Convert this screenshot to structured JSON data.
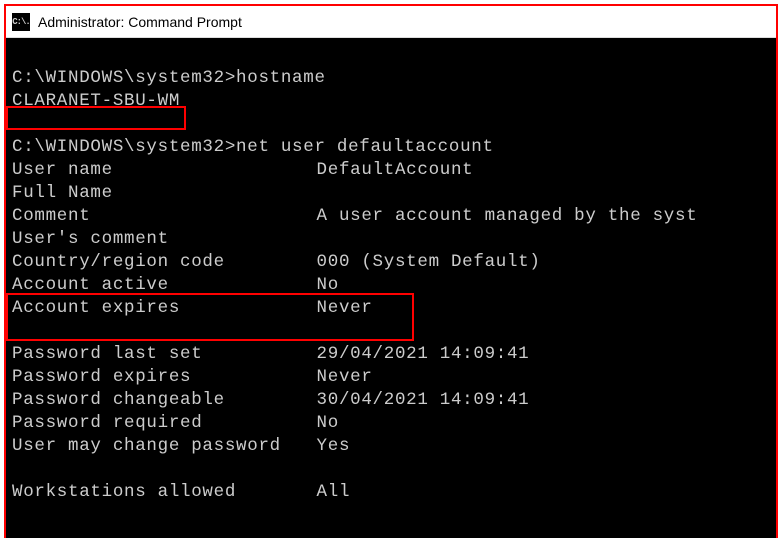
{
  "titlebar": {
    "icon_glyph": "C:\\.",
    "title": "Administrator: Command Prompt"
  },
  "terminal": {
    "prompt1_path": "C:\\WINDOWS\\system32>",
    "cmd1": "hostname",
    "hostname_out": "CLARANET-SBU-WM",
    "prompt2_path": "C:\\WINDOWS\\system32>",
    "cmd2": "net user defaultaccount",
    "rows": {
      "user_name_label": "User name",
      "user_name_value": "DefaultAccount",
      "full_name_label": "Full Name",
      "full_name_value": "",
      "comment_label": "Comment",
      "comment_value": "A user account managed by the syst",
      "users_comment_label": "User's comment",
      "users_comment_value": "",
      "country_label": "Country/region code",
      "country_value": "000 (System Default)",
      "account_active_label": "Account active",
      "account_active_value": "No",
      "account_expires_label": "Account expires",
      "account_expires_value": "Never",
      "pwd_last_set_label": "Password last set",
      "pwd_last_set_value": "29/04/2021 14:09:41",
      "pwd_expires_label": "Password expires",
      "pwd_expires_value": "Never",
      "pwd_changeable_label": "Password changeable",
      "pwd_changeable_value": "30/04/2021 14:09:41",
      "pwd_required_label": "Password required",
      "pwd_required_value": "No",
      "user_may_change_label": "User may change password",
      "user_may_change_value": "Yes",
      "workstations_label": "Workstations allowed",
      "workstations_value": "All"
    }
  }
}
